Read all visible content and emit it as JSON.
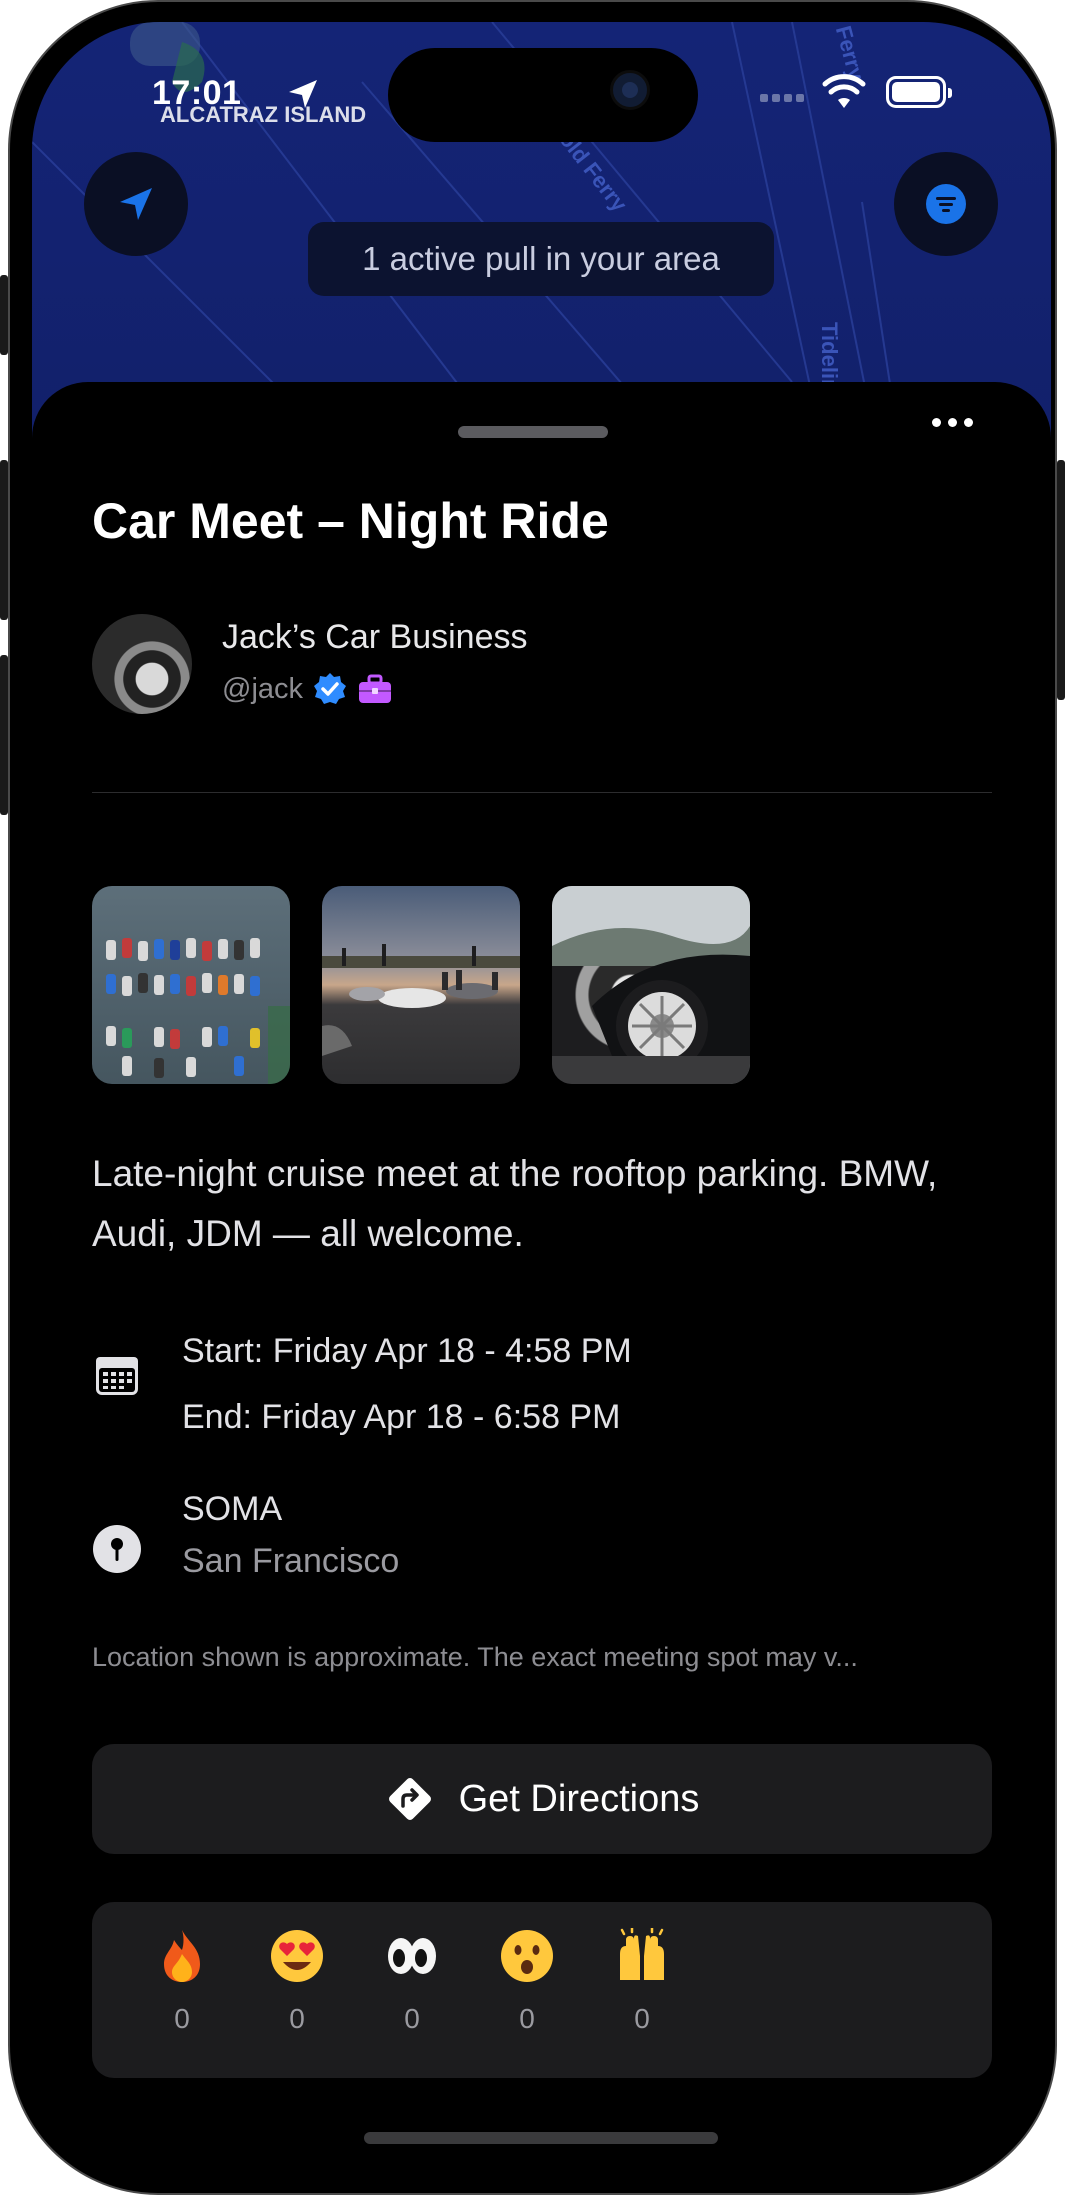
{
  "status_bar": {
    "time": "17:01",
    "map_place": "ALCATRAZ ISLAND"
  },
  "map": {
    "banner": "1 active pull in your area",
    "street_labels": [
      "Gold Ferry",
      "Tideline Ferry",
      "Ferry"
    ]
  },
  "post": {
    "title": "Car Meet – Night Ride",
    "author_name": "Jack’s Car Business",
    "author_handle": "@jack",
    "description": "Late-night cruise meet at the rooftop parking. BMW, Audi, JDM — all welcome.",
    "start": "Start: Friday Apr 18 - 4:58 PM",
    "end": "End: Friday Apr 18 - 6:58 PM",
    "location_name": "SOMA",
    "location_city": "San Francisco",
    "location_note": "Location shown is approximate. The exact meeting spot may v...",
    "directions_label": "Get Directions"
  },
  "reactions": [
    {
      "icon": "fire-emoji",
      "count": "0"
    },
    {
      "icon": "heart-eyes-emoji",
      "count": "0"
    },
    {
      "icon": "eyes-emoji",
      "count": "0"
    },
    {
      "icon": "astonished-emoji",
      "count": "0"
    },
    {
      "icon": "raised-hands-emoji",
      "count": "0"
    }
  ],
  "colors": {
    "map_bg": "#13236e",
    "sheet_bg": "#000000",
    "card_bg": "#1c1c1e",
    "accent_blue": "#1a73e8",
    "verified_blue": "#2f8cff",
    "business_purple": "#c259ff"
  }
}
